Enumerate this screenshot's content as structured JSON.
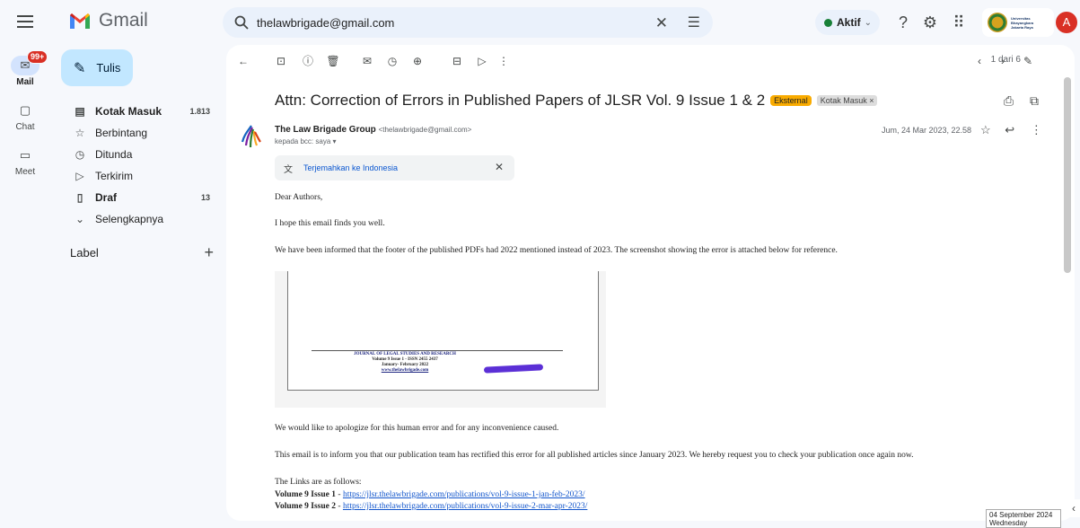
{
  "app": {
    "name": "Gmail"
  },
  "search": {
    "value": "thelawbrigade@gmail.com"
  },
  "status": {
    "label": "Aktif",
    "color": "#188038"
  },
  "account": {
    "avatar_letter": "A",
    "org_line1": "Universitas",
    "org_line2": "Bhayangkara",
    "org_line3": "Jakarta Raya"
  },
  "rail": {
    "mail": {
      "label": "Mail",
      "badge": "99+"
    },
    "chat": {
      "label": "Chat"
    },
    "meet": {
      "label": "Meet"
    }
  },
  "compose": {
    "label": "Tulis"
  },
  "nav": [
    {
      "label": "Kotak Masuk",
      "count": "1.813",
      "icon": "inbox-icon",
      "bold": true
    },
    {
      "label": "Berbintang",
      "count": "",
      "icon": "star-icon",
      "bold": false
    },
    {
      "label": "Ditunda",
      "count": "",
      "icon": "clock-icon",
      "bold": false
    },
    {
      "label": "Terkirim",
      "count": "",
      "icon": "send-icon",
      "bold": false
    },
    {
      "label": "Draf",
      "count": "13",
      "icon": "draft-icon",
      "bold": true
    },
    {
      "label": "Selengkapnya",
      "count": "",
      "icon": "chevron-down-icon",
      "bold": false
    }
  ],
  "labels": {
    "title": "Label"
  },
  "pager": {
    "text": "1 dari 6"
  },
  "email": {
    "subject": "Attn: Correction of Errors in Published Papers of JLSR Vol. 9 Issue 1 & 2",
    "tag_external": "Eksternal",
    "tag_inbox": "Kotak Masuk ×",
    "sender_name": "The Law Brigade Group",
    "sender_email": "<thelawbrigade@gmail.com>",
    "to_line": "kepada bcc: saya ▾",
    "date": "Jum, 24 Mar 2023, 22.58",
    "translate": "Terjemahkan ke Indonesia",
    "greeting": "Dear Authors,",
    "para1": "I hope this email finds you well.",
    "para2": "We have been informed that the footer of the published PDFs had 2022 mentioned instead of 2023. The screenshot showing the error is attached below for reference.",
    "shot_line1": "JOURNAL OF LEGAL STUDIES AND RESEARCH",
    "shot_line2": "Volume 9 Issue 1 - ISSN 2455 2437",
    "shot_line3": "January- February 2022",
    "shot_line4": "www.thelawbrigade.com",
    "para3": "We would like to apologize for this human error and for any inconvenience caused.",
    "para4": "This email is to inform you that our publication team has rectified this error for all published articles since January 2023. We hereby request you to check your publication once again now.",
    "links_intro": "The Links are as follows:",
    "link1_label": "Volume 9 Issue 1",
    "link1_sep": " - ",
    "link1_url": "https://jlsr.thelawbrigade.com/publications/vol-9-issue-1-jan-feb-2023/",
    "link2_label": "Volume 9 Issue 2",
    "link2_sep": " - ",
    "link2_url": "https://jlsr.thelawbrigade.com/publications/vol-9-issue-2-mar-apr-2023/"
  },
  "tooltip": {
    "line1": "04 September 2024",
    "line2": "Wednesday"
  }
}
